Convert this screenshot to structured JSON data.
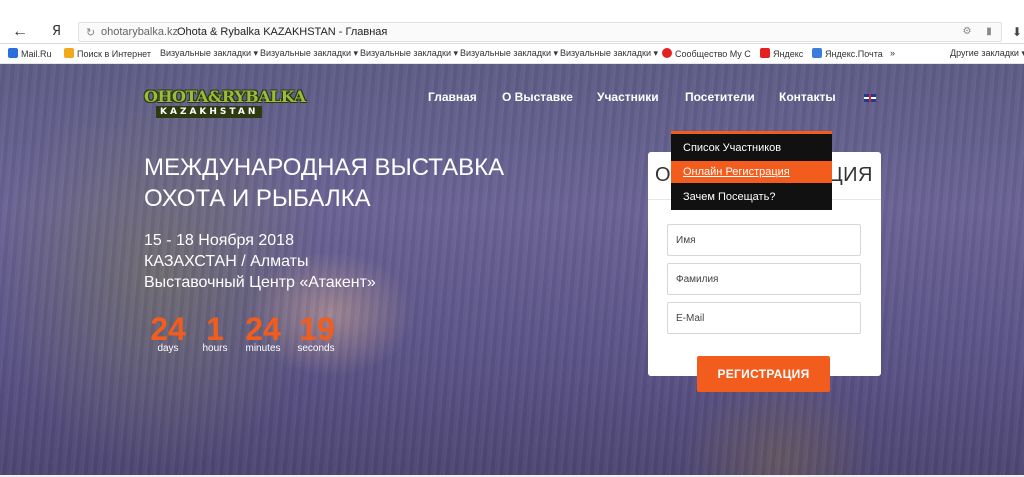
{
  "browser": {
    "back_icon": "back-arrow-icon",
    "ya_logo": "Я",
    "url_domain": "ohotarybalka.kz",
    "page_title": "Ohota & Rybalka KAZAKHSTAN - Главная",
    "more_bookmarks": "»",
    "bookmarks": [
      {
        "label": "Mail.Ru",
        "color": "#2a6fdb"
      },
      {
        "label": "Поиск в Интернет",
        "color": "#f2a81d"
      },
      {
        "label": "Визуальные закладки ▾",
        "color": ""
      },
      {
        "label": "Визуальные закладки ▾",
        "color": ""
      },
      {
        "label": "Визуальные закладки ▾",
        "color": ""
      },
      {
        "label": "Визуальные закладки ▾",
        "color": ""
      },
      {
        "label": "Визуальные закладки ▾",
        "color": ""
      },
      {
        "label": "Сообщество My С",
        "color": "#e52020"
      },
      {
        "label": "Яндекс",
        "color": "#e52020"
      },
      {
        "label": "Яндекс.Почта",
        "color": "#3b7ddd"
      }
    ],
    "other_bookmarks": "Другие закладки ▾"
  },
  "site": {
    "logo_top": "OHOTA&RYBALKA",
    "logo_bottom": "KAZAKHSTAN",
    "nav": [
      "Главная",
      "О Выставке",
      "Участники",
      "Посетители",
      "Контакты"
    ],
    "dropdown": [
      "Список Участников",
      "Онлайн Регистрация",
      "Зачем Посещать?"
    ],
    "accent": "#f25c1d"
  },
  "hero": {
    "headline_1": "МЕЖДУНАРОДНАЯ ВЫСТАВКА",
    "headline_2": "ОХОТА И РЫБАЛКА",
    "dates": "15 - 18 Ноября 2018",
    "location": "КАЗАХСТАН / Алматы",
    "venue": "Выставочный Центр «Атакент»"
  },
  "countdown": [
    {
      "value": "24",
      "label": "days"
    },
    {
      "value": "1",
      "label": "hours"
    },
    {
      "value": "24",
      "label": "minutes"
    },
    {
      "value": "19",
      "label": "seconds"
    }
  ],
  "registration": {
    "title_left": "О",
    "title_right": "ЦИЯ",
    "first_name_placeholder": "Имя",
    "last_name_placeholder": "Фамилия",
    "email_placeholder": "E-Mail",
    "submit_label": "РЕГИСТРАЦИЯ"
  }
}
